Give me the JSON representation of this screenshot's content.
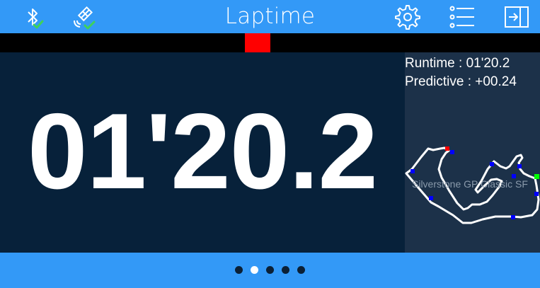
{
  "header": {
    "title": "Laptime",
    "icons": {
      "left1": "bluetooth-connected-icon",
      "left2": "gps-satellite-connected-icon",
      "right1": "gear-icon",
      "right2": "list-icon",
      "right3": "exit-icon"
    }
  },
  "delta_strip": {
    "marker_color": "#ff0000"
  },
  "main": {
    "laptime": "01'20.2"
  },
  "side": {
    "runtime_label": "Runtime : ",
    "runtime_value": "01'20.2",
    "predictive_label": "Predictive : ",
    "predictive_value": "+00.24",
    "track_name": "Silverstone GP Classic SF"
  },
  "pager": {
    "page_count": 5,
    "active_index": 1
  },
  "colors": {
    "accent": "#3399f7",
    "background": "#07213a",
    "side_panel": "#1c3149",
    "check": "#3fd15a",
    "sector_marker": "#0000ff",
    "start_marker": "#ff0000",
    "finish_marker": "#00ff00"
  }
}
